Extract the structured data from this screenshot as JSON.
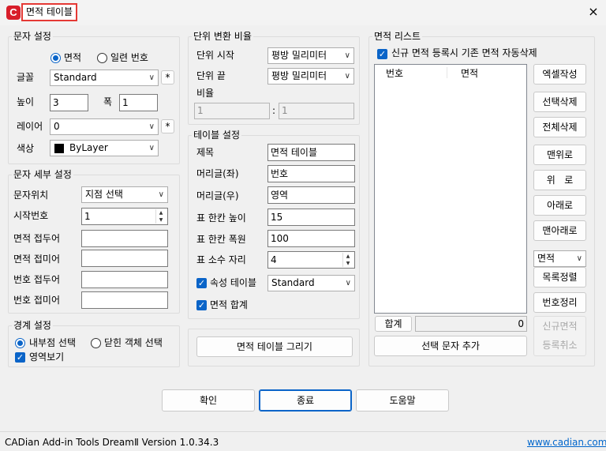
{
  "window": {
    "title": "면적 테이블",
    "app_icon": "C",
    "close_icon": "×"
  },
  "text_settings": {
    "legend": "문자 설정",
    "radio_area": "면적",
    "radio_serial": "일련 번호",
    "font_label": "글꼴",
    "font_value": "Standard",
    "font_more": "*",
    "height_label": "높이",
    "height_value": "3",
    "width_label": "폭",
    "width_value": "1",
    "layer_label": "레이어",
    "layer_value": "0",
    "layer_more": "*",
    "color_label": "색상",
    "color_value": "ByLayer"
  },
  "text_detail": {
    "legend": "문자 세부 설정",
    "position_label": "문자위치",
    "position_value": "지점 선택",
    "start_label": "시작번호",
    "start_value": "1",
    "area_prefix_label": "면적 접두어",
    "area_suffix_label": "면적 접미어",
    "num_prefix_label": "번호 접두어",
    "num_suffix_label": "번호 접미어"
  },
  "boundary": {
    "legend": "경계 설정",
    "radio_internal": "내부점 선택",
    "radio_closed": "닫힌 객체 선택",
    "check_view": "영역보기"
  },
  "unit": {
    "legend": "단위 변환 비율",
    "start_label": "단위 시작",
    "start_value": "평방 밀리미터",
    "end_label": "단위 끝",
    "end_value": "평방 밀리미터",
    "ratio_label": "비율",
    "ratio_a": "1",
    "ratio_sep": ":",
    "ratio_b": "1"
  },
  "table": {
    "legend": "테이블 설정",
    "title_label": "제목",
    "title_value": "면적 테이블",
    "header_left_label": "머리글(좌)",
    "header_left_value": "번호",
    "header_right_label": "머리글(우)",
    "header_right_value": "영역",
    "row_height_label": "표 한칸 높이",
    "row_height_value": "15",
    "col_width_label": "표 한칸 폭원",
    "col_width_value": "100",
    "decimals_label": "표 소수 자리",
    "decimals_value": "4",
    "attr_table_label": "속성 테이블",
    "attr_table_value": "Standard",
    "area_sum_label": "면적 합계"
  },
  "draw_button": "면적 테이블 그리기",
  "area_list": {
    "legend": "면적 리스트",
    "auto_delete_label": "신규 면적 등록시 기존 면적 자동삭제",
    "col_number": "번호",
    "col_area": "면적",
    "total_label": "합계",
    "total_value": "0",
    "add_selected_text": "선택 문자 추가",
    "buttons": {
      "excel": "엑셀작성",
      "delete_selected": "선택삭제",
      "delete_all": "전체삭제",
      "top": "맨위로",
      "up": "위   로",
      "down": "아래로",
      "bottom": "맨아래로",
      "sort_select": "면적",
      "sort_list": "목록정렬",
      "renumber": "번호정리",
      "new_area": "신규면적",
      "cancel_register": "등록취소"
    }
  },
  "footer": {
    "ok": "확인",
    "close": "종료",
    "help": "도움말"
  },
  "status": {
    "product": "CADian Add-in Tools DreamⅡ  Version  1.0.34.3",
    "website": "www.cadian.com"
  }
}
